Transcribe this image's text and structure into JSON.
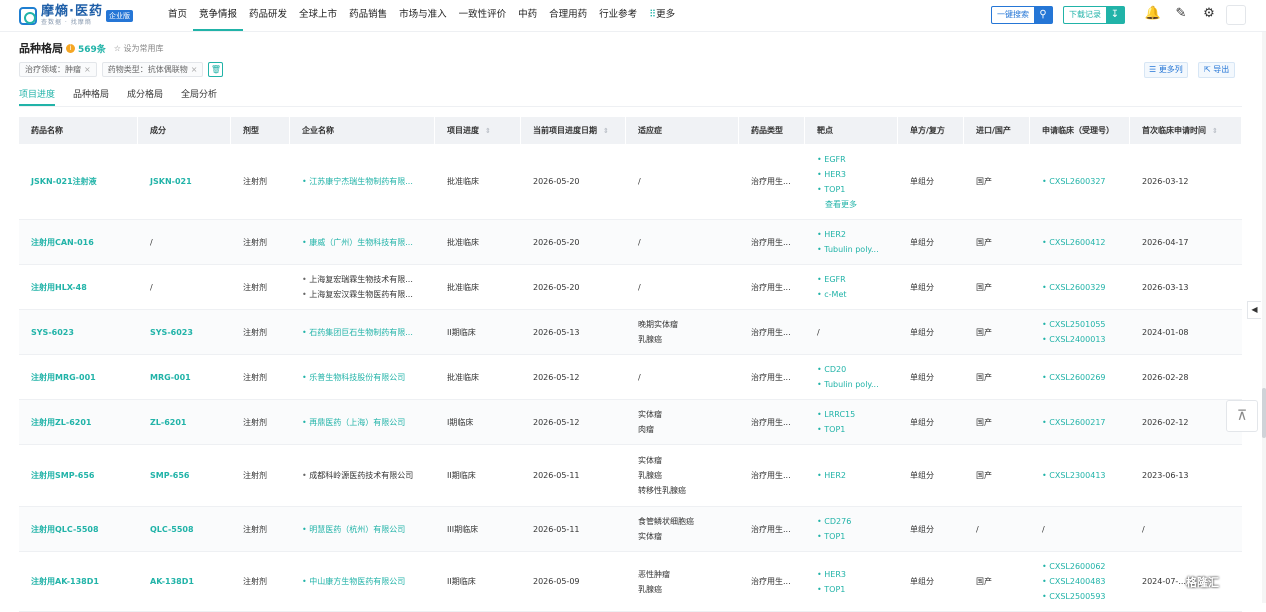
{
  "brand": {
    "title": "摩熵·医药",
    "subtitle": "查数据 · 找摩熵",
    "edition": "企业版"
  },
  "nav": [
    {
      "label": "首页",
      "active": false
    },
    {
      "label": "竞争情报",
      "active": true
    },
    {
      "label": "药品研发",
      "active": false
    },
    {
      "label": "全球上市",
      "active": false
    },
    {
      "label": "药品销售",
      "active": false
    },
    {
      "label": "市场与准入",
      "active": false
    },
    {
      "label": "一致性评价",
      "active": false
    },
    {
      "label": "中药",
      "active": false
    },
    {
      "label": "合理用药",
      "active": false
    },
    {
      "label": "行业参考",
      "active": false
    },
    {
      "label": "更多",
      "active": false
    }
  ],
  "header_actions": {
    "search_label": "一键搜索",
    "download_label": "下载记录"
  },
  "page": {
    "title": "品种格局",
    "count": "569条",
    "favorite": "设为常用库"
  },
  "filters": [
    "治疗领域：肿瘤",
    "药物类型：抗体偶联物"
  ],
  "toolbar": {
    "more_cols": "更多列",
    "export": "导出"
  },
  "subtabs": [
    {
      "label": "项目进度",
      "active": true
    },
    {
      "label": "品种格局",
      "active": false
    },
    {
      "label": "成分格局",
      "active": false
    },
    {
      "label": "全局分析",
      "active": false
    }
  ],
  "columns": [
    {
      "label": "药品名称",
      "sortable": false
    },
    {
      "label": "成分",
      "sortable": false
    },
    {
      "label": "剂型",
      "sortable": false
    },
    {
      "label": "企业名称",
      "sortable": false
    },
    {
      "label": "项目进度",
      "sortable": true
    },
    {
      "label": "当前项目进度日期",
      "sortable": true
    },
    {
      "label": "适应症",
      "sortable": false
    },
    {
      "label": "药品类型",
      "sortable": false
    },
    {
      "label": "靶点",
      "sortable": false
    },
    {
      "label": "单方/复方",
      "sortable": false
    },
    {
      "label": "进口/国产",
      "sortable": false
    },
    {
      "label": "申请临床（受理号）",
      "sortable": false
    },
    {
      "label": "首次临床申请时间",
      "sortable": true
    }
  ],
  "rows": [
    {
      "name": "JSKN-021注射液",
      "component": "JSKN-021",
      "form": "注射剂",
      "companies": [
        "江苏康宁杰瑞生物制药有限..."
      ],
      "company_link": true,
      "progress": "批准临床",
      "date": "2026-05-20",
      "indications": [
        "/"
      ],
      "type": "治疗用生...",
      "targets": [
        "EGFR",
        "HER3",
        "TOP1"
      ],
      "targets_more": "查看更多",
      "combo": "单组分",
      "origin": "国产",
      "accept": [
        "CXSL2600327"
      ],
      "first": "2026-03-12",
      "h": 76
    },
    {
      "name": "注射用CAN-016",
      "component": "/",
      "form": "注射剂",
      "companies": [
        "康威（广州）生物科技有限..."
      ],
      "company_link": true,
      "progress": "批准临床",
      "date": "2026-05-20",
      "indications": [
        "/"
      ],
      "type": "治疗用生...",
      "targets": [
        "HER2",
        "Tubulin poly..."
      ],
      "targets_more": "",
      "combo": "单组分",
      "origin": "国产",
      "accept": [
        "CXSL2600412"
      ],
      "first": "2026-04-17",
      "h": 45
    },
    {
      "name": "注射用HLX-48",
      "component": "/",
      "form": "注射剂",
      "companies": [
        "上海复宏瑞霖生物技术有限...",
        "上海复宏汉霖生物医药有限..."
      ],
      "company_link": "mixed",
      "progress": "批准临床",
      "date": "2026-05-20",
      "indications": [
        "/"
      ],
      "type": "治疗用生...",
      "targets": [
        "EGFR",
        "c-Met"
      ],
      "targets_more": "",
      "combo": "单组分",
      "origin": "国产",
      "accept": [
        "CXSL2600329"
      ],
      "first": "2026-03-13",
      "h": 45
    },
    {
      "name": "SYS-6023",
      "component": "SYS-6023",
      "form": "注射剂",
      "companies": [
        "石药集团巨石生物制药有限..."
      ],
      "company_link": true,
      "progress": "II期临床",
      "date": "2026-05-13",
      "indications": [
        "晚期实体瘤",
        "乳腺癌"
      ],
      "type": "治疗用生...",
      "targets": [],
      "targets_none": "/",
      "targets_more": "",
      "combo": "单组分",
      "origin": "国产",
      "accept": [
        "CXSL2501055",
        "CXSL2400013"
      ],
      "first": "2024-01-08",
      "h": 45
    },
    {
      "name": "注射用MRG-001",
      "component": "MRG-001",
      "form": "注射剂",
      "companies": [
        "乐普生物科技股份有限公司"
      ],
      "company_link": true,
      "progress": "批准临床",
      "date": "2026-05-12",
      "indications": [
        "/"
      ],
      "type": "治疗用生...",
      "targets": [
        "CD20",
        "Tubulin poly..."
      ],
      "targets_more": "",
      "combo": "单组分",
      "origin": "国产",
      "accept": [
        "CXSL2600269"
      ],
      "first": "2026-02-28",
      "h": 45
    },
    {
      "name": "注射用ZL-6201",
      "component": "ZL-6201",
      "form": "注射剂",
      "companies": [
        "再鼎医药（上海）有限公司"
      ],
      "company_link": true,
      "progress": "I期临床",
      "date": "2026-05-12",
      "indications": [
        "实体瘤",
        "肉瘤"
      ],
      "type": "治疗用生...",
      "targets": [
        "LRRC15",
        "TOP1"
      ],
      "targets_more": "",
      "combo": "单组分",
      "origin": "国产",
      "accept": [
        "CXSL2600217"
      ],
      "first": "2026-02-12",
      "h": 45
    },
    {
      "name": "注射用SMP-656",
      "component": "SMP-656",
      "form": "注射剂",
      "companies": [
        "成都科岭源医药技术有限公司"
      ],
      "company_link": false,
      "progress": "II期临床",
      "date": "2026-05-11",
      "indications": [
        "实体瘤",
        "乳腺癌",
        "转移性乳腺癌"
      ],
      "type": "治疗用生...",
      "targets": [
        "HER2"
      ],
      "targets_more": "",
      "combo": "单组分",
      "origin": "国产",
      "accept": [
        "CXSL2300413"
      ],
      "first": "2023-06-13",
      "h": 62
    },
    {
      "name": "注射用QLC-5508",
      "component": "QLC-5508",
      "form": "注射剂",
      "companies": [
        "明慧医药（杭州）有限公司"
      ],
      "company_link": true,
      "progress": "III期临床",
      "date": "2026-05-11",
      "indications": [
        "食管鳞状细胞癌",
        "实体瘤"
      ],
      "type": "治疗用生...",
      "targets": [
        "CD276",
        "TOP1"
      ],
      "targets_more": "",
      "combo": "单组分",
      "origin": "/",
      "accept": [],
      "accept_none": "/",
      "first": "/",
      "h": 45
    },
    {
      "name": "注射用AK-138D1",
      "component": "AK-138D1",
      "form": "注射剂",
      "companies": [
        "中山康方生物医药有限公司"
      ],
      "company_link": true,
      "progress": "II期临床",
      "date": "2026-05-09",
      "indications": [
        "恶性肿瘤",
        "乳腺癌"
      ],
      "type": "治疗用生...",
      "targets": [
        "HER3",
        "TOP1"
      ],
      "targets_more": "",
      "combo": "单组分",
      "origin": "国产",
      "accept": [
        "CXSL2600062",
        "CXSL2400483",
        "CXSL2500593"
      ],
      "first": "2024-07-...",
      "h": 60
    }
  ],
  "watermark": "格隆汇"
}
